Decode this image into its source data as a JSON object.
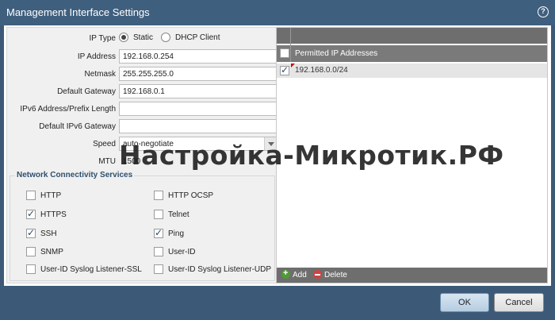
{
  "dialog": {
    "title": "Management Interface Settings",
    "help_icon": "help-icon"
  },
  "form": {
    "ip_type_label": "IP Type",
    "ip_type_static": "Static",
    "ip_type_dhcp": "DHCP Client",
    "ip_type_selected": "Static",
    "ip_address_label": "IP Address",
    "ip_address_value": "192.168.0.254",
    "netmask_label": "Netmask",
    "netmask_value": "255.255.255.0",
    "gateway_label": "Default Gateway",
    "gateway_value": "192.168.0.1",
    "ipv6_label": "IPv6 Address/Prefix Length",
    "ipv6_value": "",
    "ipv6_gateway_label": "Default IPv6 Gateway",
    "ipv6_gateway_value": "",
    "speed_label": "Speed",
    "speed_value": "auto-negotiate",
    "mtu_label": "MTU",
    "mtu_value": "1500"
  },
  "services": {
    "title": "Network Connectivity Services",
    "items": [
      {
        "label": "HTTP",
        "checked": false
      },
      {
        "label": "HTTP OCSP",
        "checked": false
      },
      {
        "label": "HTTPS",
        "checked": true
      },
      {
        "label": "Telnet",
        "checked": false
      },
      {
        "label": "SSH",
        "checked": true
      },
      {
        "label": "Ping",
        "checked": true
      },
      {
        "label": "SNMP",
        "checked": false
      },
      {
        "label": "User-ID",
        "checked": false
      },
      {
        "label": "User-ID Syslog Listener-SSL",
        "checked": false
      },
      {
        "label": "User-ID Syslog Listener-UDP",
        "checked": false
      }
    ]
  },
  "permitted": {
    "header": "Permitted IP Addresses",
    "rows": [
      "192.168.0.0/24"
    ],
    "add_label": "Add",
    "delete_label": "Delete"
  },
  "buttons": {
    "ok": "OK",
    "cancel": "Cancel"
  },
  "watermark": "Настройка-Микротик.РФ"
}
